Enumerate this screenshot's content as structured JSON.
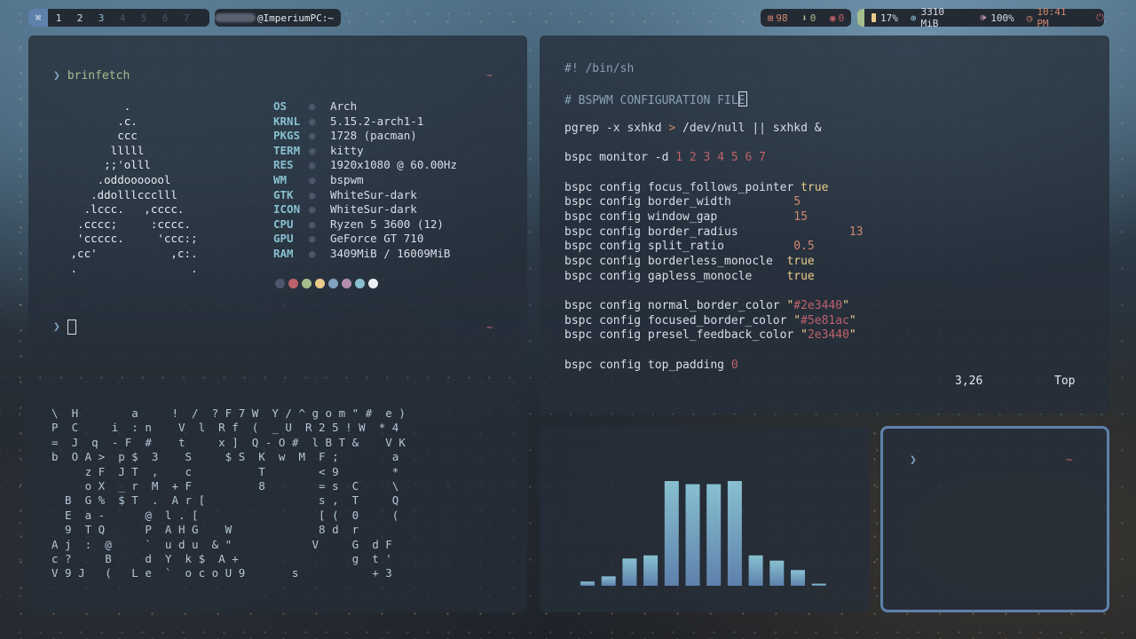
{
  "topbar": {
    "workspace_icon": "⌘",
    "workspaces": [
      "1",
      "2",
      "3",
      "4",
      "5",
      "6",
      "7"
    ],
    "active_workspace": "3",
    "occupied_workspaces": [
      "1",
      "2"
    ],
    "host": "@ImperiumPC:~",
    "stats": [
      {
        "icon": "package-icon",
        "glyph": "⊞",
        "value": "98"
      },
      {
        "icon": "download-icon",
        "glyph": "⬇",
        "value": "0"
      },
      {
        "icon": "github-icon",
        "glyph": "◉",
        "value": "0"
      }
    ],
    "cpu": "17%",
    "memory": "3310 MiB",
    "volume": "100%",
    "time": "10:41 PM",
    "power_glyph": "⏻",
    "colors": {
      "accent": "#5e81ac",
      "green": "#a3be8c",
      "orange": "#d08770",
      "red": "#bf616a",
      "cyan": "#88c0d0",
      "purple": "#b48ead"
    }
  },
  "fetch": {
    "command": "brinfetch",
    "tilde": "~",
    "ascii": "         .\n        .c.\n        ccc\n       lllll\n      ;;'olll\n     .oddooooool\n    .ddolllccclll\n   .lccc.   ,cccc.\n  .cccc;     :cccc.\n  'ccccc.     'ccc:;\n ,cc'           ,c:.\n .                 .",
    "info": [
      {
        "key": "OS",
        "value": "Arch"
      },
      {
        "key": "KRNL",
        "value": "5.15.2-arch1-1"
      },
      {
        "key": "PKGS",
        "value": "1728 (pacman)"
      },
      {
        "key": "TERM",
        "value": "kitty"
      },
      {
        "key": "RES",
        "value": "1920x1080 @ 60.00Hz"
      },
      {
        "key": "WM",
        "value": "bspwm"
      },
      {
        "key": "GTK",
        "value": "WhiteSur-dark"
      },
      {
        "key": "ICON",
        "value": "WhiteSur-dark"
      },
      {
        "key": "CPU",
        "value": "Ryzen 5 3600 (12)"
      },
      {
        "key": "GPU",
        "value": "GeForce GT 710"
      },
      {
        "key": "RAM",
        "value": "3409MiB / 16009MiB"
      }
    ],
    "bullet": "●",
    "palette": [
      "#4c566a",
      "#bf616a",
      "#a3be8c",
      "#ebcb8b",
      "#81a1c1",
      "#b48ead",
      "#88c0d0",
      "#eceff4"
    ],
    "prompt_arrow": "❯"
  },
  "matrix": {
    "text": "\\  H        a     !  /  ? F 7 W  Y / ^ g o m \" #  e )\nP  C     i  : n    V  l  R f  (  _ U  R 2 5 ! W  * 4\n=  J  q  - F  #    t     x ]  Q - O #  l B T &    V K\nb  O A >  p $  3    S     $ S  K  w  M  F ;        a\n     z F  J T  ,    c          T        < 9        *\n     o X  _ r  M  + F          8        = s  C     \\\n  B  G %  $ T  .  A r [                 s ,  T     Q\n  E  a -      @  l . [                  [ (  0     (\n  9  T Q      P  A H G    W             8 d  r\nA j  :  @     `  u d u  & \"            V     G  d F\nc ?     B     d  Y  k $  A +                 g  t '\nV 9 J   (   L e  `  o c o U 9       s           + 3"
  },
  "editor": {
    "lines": [
      [
        {
          "t": "#! /bin/sh",
          "c": "c-comment"
        }
      ],
      [],
      [
        {
          "t": "# BSPWM CONFIGURATION FILE",
          "c": "c-comment"
        }
      ],
      [],
      [
        {
          "t": "pgrep -x sxhkd "
        },
        {
          "t": ">",
          "c": "c-op"
        },
        {
          "t": " /dev/null || sxhkd &"
        }
      ],
      [],
      [
        {
          "t": "bspc monitor -d "
        },
        {
          "t": "1 2 3 4 5 6 7",
          "c": "c-num"
        }
      ],
      [],
      [
        {
          "t": "bspc config focus_follows_pointer "
        },
        {
          "t": "true",
          "c": "c-bool"
        }
      ],
      [
        {
          "t": "bspc config border_width         "
        },
        {
          "t": "5",
          "c": "c-num2"
        }
      ],
      [
        {
          "t": "bspc config window_gap           "
        },
        {
          "t": "15",
          "c": "c-num2"
        }
      ],
      [
        {
          "t": "bspc config border_radius                "
        },
        {
          "t": "13",
          "c": "c-num2"
        }
      ],
      [
        {
          "t": "bspc config split_ratio          "
        },
        {
          "t": "0.5",
          "c": "c-num2"
        }
      ],
      [
        {
          "t": "bspc config borderless_monocle  "
        },
        {
          "t": "true",
          "c": "c-bool"
        }
      ],
      [
        {
          "t": "bspc config gapless_monocle     "
        },
        {
          "t": "true",
          "c": "c-bool"
        }
      ],
      [],
      [
        {
          "t": "bspc config normal_border_color "
        },
        {
          "t": "\"",
          "c": "c-q"
        },
        {
          "t": "#2e3440",
          "c": "c-strv"
        },
        {
          "t": "\"",
          "c": "c-q"
        }
      ],
      [
        {
          "t": "bspc config focused_border_color "
        },
        {
          "t": "\"",
          "c": "c-q"
        },
        {
          "t": "#5e81ac",
          "c": "c-strv"
        },
        {
          "t": "\"",
          "c": "c-q"
        }
      ],
      [
        {
          "t": "bspc config presel_feedback_color "
        },
        {
          "t": "\"",
          "c": "c-q"
        },
        {
          "t": "2e3440",
          "c": "c-strv"
        },
        {
          "t": "\"",
          "c": "c-q"
        }
      ],
      [],
      [
        {
          "t": "bspc config top_padding "
        },
        {
          "t": "0",
          "c": "c-num"
        }
      ]
    ],
    "cursor_position": "3,26",
    "scroll_position": "Top"
  },
  "visualizer": {
    "levels": [
      0.04,
      0.09,
      0.26,
      0.29,
      1.0,
      0.97,
      0.97,
      1.0,
      0.29,
      0.24,
      0.15,
      0.02
    ]
  },
  "terminal": {
    "prompt_arrow": "❯",
    "tilde": "~"
  }
}
